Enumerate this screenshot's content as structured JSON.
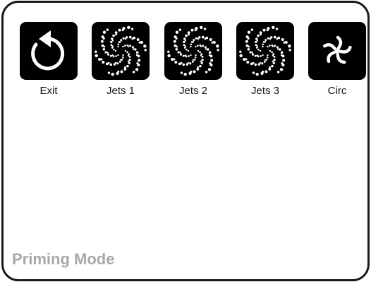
{
  "buttons": [
    {
      "label": "Exit",
      "icon": "exit-icon"
    },
    {
      "label": "Jets 1",
      "icon": "jets-icon"
    },
    {
      "label": "Jets 2",
      "icon": "jets-icon"
    },
    {
      "label": "Jets 3",
      "icon": "jets-icon"
    },
    {
      "label": "Circ",
      "icon": "circ-pump-icon"
    }
  ],
  "status": {
    "mode": "Priming Mode"
  },
  "colors": {
    "tile": "#000000",
    "icon": "#ffffff",
    "label": "#111111",
    "status": "#a8a8a8",
    "border": "#1a1a1a"
  }
}
